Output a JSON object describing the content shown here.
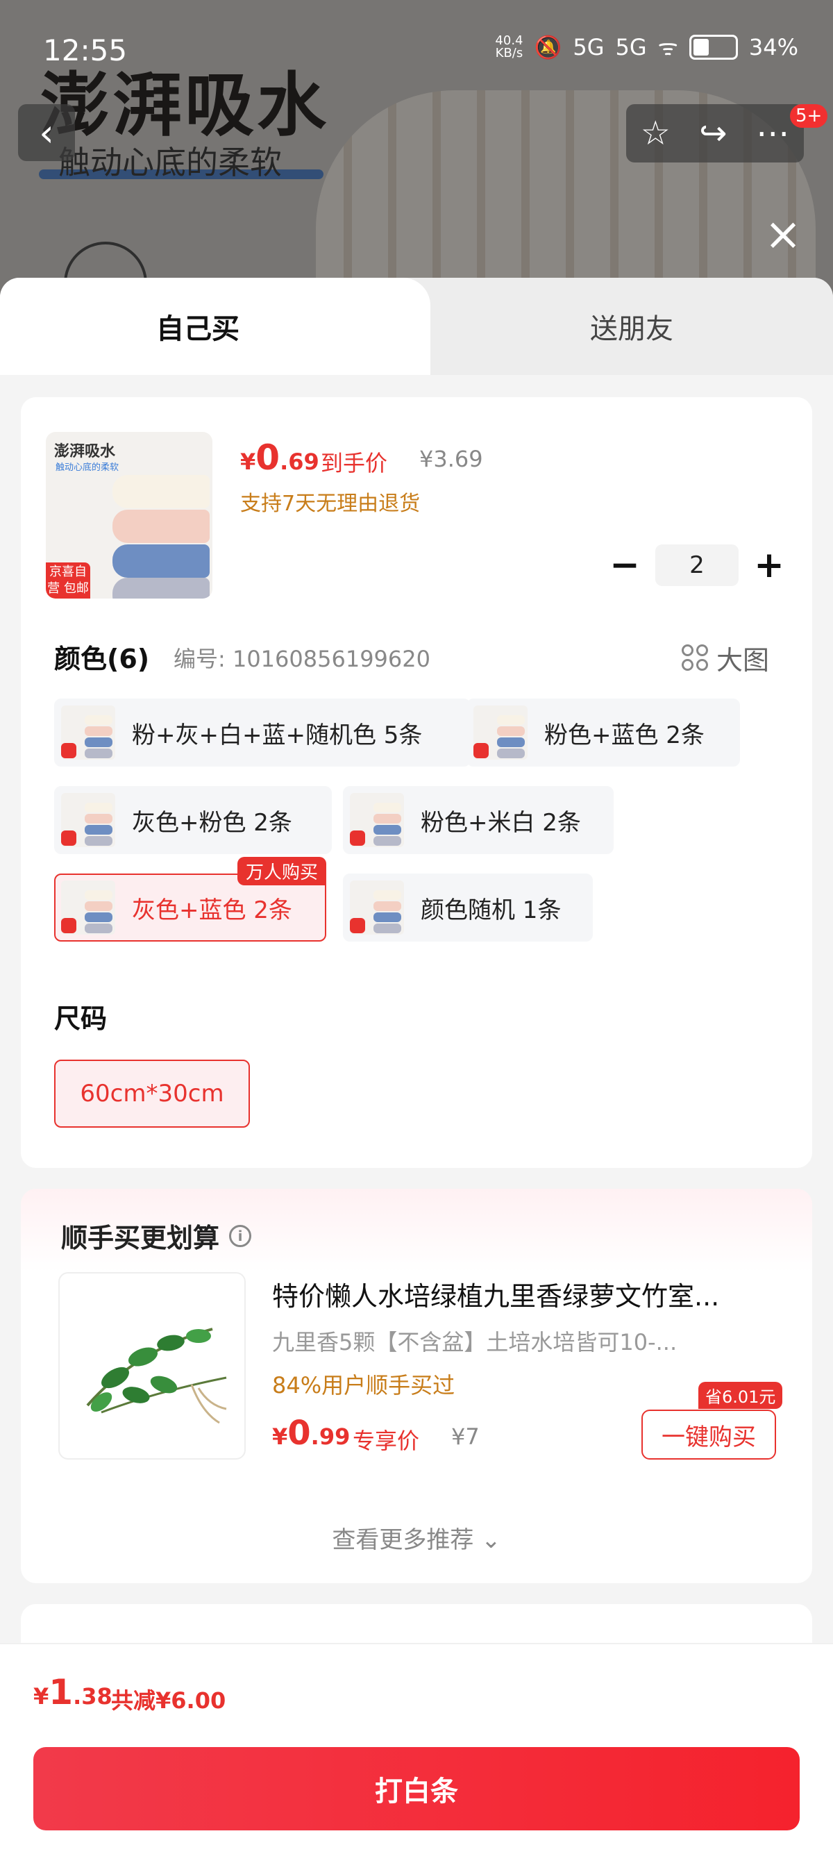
{
  "status_bar": {
    "time": "12:55",
    "net_speed_top": "40.4",
    "net_speed_unit": "KB/s",
    "signal1": "5G",
    "signal2": "5G",
    "battery": "34%"
  },
  "background": {
    "title": "澎湃吸水",
    "subtitle": "触动心底的柔软",
    "badge": "5+"
  },
  "tabs": {
    "self": "自己买",
    "friend": "送朋友"
  },
  "product": {
    "price_yen": "¥",
    "price_int": "0",
    "price_dec": ".69",
    "price_label": "到手价",
    "original_price": "¥3.69",
    "return_note": "支持7天无理由退货",
    "quantity": "2",
    "thumb_title": "澎湃吸水",
    "thumb_sub": "触动心底的柔软",
    "thumb_tag": "京喜自营 包邮"
  },
  "color_section": {
    "title": "颜色(6)",
    "code": "编号: 10160856199620",
    "big_pic": "大图",
    "options": [
      {
        "label": "粉+灰+白+蓝+随机色 5条"
      },
      {
        "label": "粉色+蓝色 2条"
      },
      {
        "label": "灰色+粉色 2条"
      },
      {
        "label": "粉色+米白 2条"
      },
      {
        "label": "灰色+蓝色 2条",
        "badge": "万人购买"
      },
      {
        "label": "颜色随机 1条"
      }
    ]
  },
  "size_section": {
    "title": "尺码",
    "option": "60cm*30cm"
  },
  "recommend": {
    "title": "顺手买更划算",
    "item_title": "特价懒人水培绿植九里香绿萝文竹室...",
    "item_desc": "九里香5颗【不含盆】土培水培皆可10-...",
    "bought": "84%用户顺手买过",
    "price_yen": "¥",
    "price_int": "0",
    "price_dec": ".99",
    "price_label": "专享价",
    "original_price": "¥7",
    "save_tag": "省6.01元",
    "buy_label": "一键购买",
    "more": "查看更多推荐 ⌄"
  },
  "footer": {
    "total_yen": "¥",
    "total_int": "1",
    "total_dec": ".38",
    "total_save": "共减¥6.00",
    "pay_button": "打白条"
  }
}
